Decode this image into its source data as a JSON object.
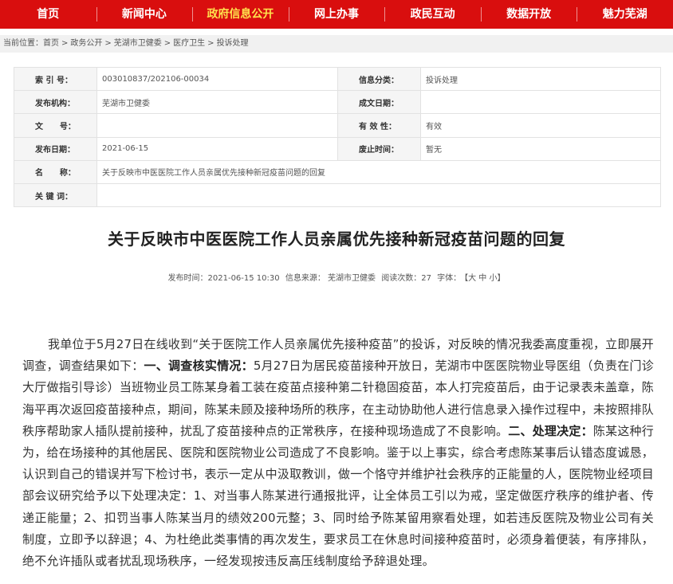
{
  "nav": {
    "items": [
      {
        "label": "首页"
      },
      {
        "label": "新闻中心"
      },
      {
        "label": "政府信息公开"
      },
      {
        "label": "网上办事"
      },
      {
        "label": "政民互动"
      },
      {
        "label": "数据开放"
      },
      {
        "label": "魅力芜湖"
      }
    ],
    "active_index": 2,
    "colors": {
      "bg": "#d90e0e",
      "active_text": "#ffe14d"
    }
  },
  "breadcrumb": {
    "prefix": "当前位置：",
    "items": [
      "首页",
      "政务公开",
      "芜湖市卫健委",
      "医疗卫生",
      "投诉处理"
    ],
    "separator": ">"
  },
  "meta": {
    "rows": [
      {
        "k1": "索 引 号：",
        "v1": "003010837/202106-00034",
        "k2": "信息分类：",
        "v2": "投诉处理"
      },
      {
        "k1": "发布机构：",
        "v1": "芜湖市卫健委",
        "k2": "成文日期：",
        "v2": ""
      },
      {
        "k1": "文      号：",
        "v1": "",
        "k2": "有 效 性：",
        "v2": "有效"
      },
      {
        "k1": "发布日期：",
        "v1": "2021-06-15",
        "k2": "废止时间：",
        "v2": "暂无"
      }
    ],
    "name_label": "名      称：",
    "name_value": "关于反映市中医医院工作人员亲属优先接种新冠疫苗问题的回复",
    "keyword_label": "关 键 词：",
    "keyword_value": ""
  },
  "article": {
    "title": "关于反映市中医医院工作人员亲属优先接种新冠疫苗问题的回复",
    "publish_time": "发布时间：2021-06-15 10:30",
    "source": "信息来源： 芜湖市卫健委",
    "views": "阅读次数：27",
    "font_label": "字体：",
    "font_size_controls": "【大 中 小】",
    "body": {
      "p1": "我单位于5月27日在线收到“关于医院工作人员亲属优先接种疫苗”的投诉，对反映的情况我委高度重视，立即展开调查，调查结果如下：",
      "h1": "一、调查核实情况：",
      "p2": "5月27日为居民疫苗接种开放日，芜湖市中医医院物业导医组（负责在门诊大厅做指引导诊）当班物业员工陈某身着工装在疫苗点接种第二针稳固疫苗，本人打完疫苗后，由于记录表未盖章，陈海平再次返回疫苗接种点，期间，陈某未顾及接种场所的秩序，在主动协助他人进行信息录入操作过程中，未按照排队秩序帮助家人插队提前接种，扰乱了疫苗接种点的正常秩序，在接种现场造成了不良影响。",
      "h2": "二、处理决定：",
      "p3": "陈某这种行为，给在场接种的其他居民、医院和医院物业公司造成了不良影响。鉴于以上事实，综合考虑陈某事后认错态度诚恳，认识到自己的错误并写下检讨书，表示一定从中汲取教训，做一个恪守并维护社会秩序的正能量的人，医院物业经项目部会议研究给予以下处理决定：1、对当事人陈某进行通报批评，让全体员工引以为戒，坚定做医疗秩序的维护者、传递正能量；2、扣罚当事人陈某当月的绩效200元整；3、同时给予陈某留用察看处理，如若违反医院及物业公司有关制度，立即予以辞退；4、为杜绝此类事情的再次发生，要求员工在休息时间接种疫苗时，必须身着便装，有序排队，绝不允许插队或者扰乱现场秩序，一经发现按违反高压线制度给予辞退处理。"
    }
  }
}
